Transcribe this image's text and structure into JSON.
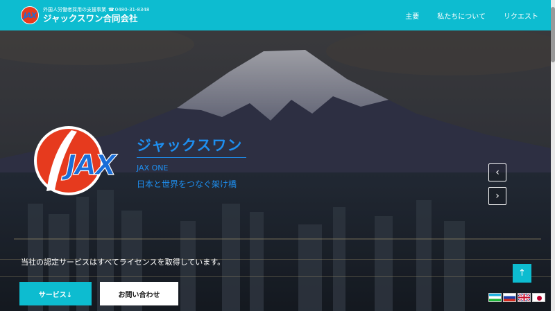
{
  "header": {
    "logo_mark": "JAX",
    "tagline": "外国人労働者採用の支援事業",
    "phone": "0480-31-8348",
    "brand_name": "ジャックスワン合同会社",
    "nav": [
      {
        "label": "主要"
      },
      {
        "label": "私たちについて"
      },
      {
        "label": "リクエスト"
      }
    ]
  },
  "hero": {
    "logo_mark": "JAX",
    "title": "ジャックスワン",
    "subtitle_1": "JAX ONE",
    "subtitle_2": "日本と世界をつなぐ架け橋",
    "prev_icon": "‹",
    "next_icon": "›",
    "notice": "当社の認定サービスはすべてライセンスを取得しています。",
    "services_button": "サービス↓",
    "contact_button": "お問い合わせ",
    "to_top_icon": "↑"
  },
  "language_flags": [
    "uzbekistan-flag",
    "russia-flag",
    "uk-flag",
    "japan-flag"
  ],
  "colors": {
    "accent": "#0dbcd0",
    "logo_red": "#e63a1e",
    "logo_blue": "#1a6ed8",
    "hero_text_blue": "#1e8ff0"
  }
}
